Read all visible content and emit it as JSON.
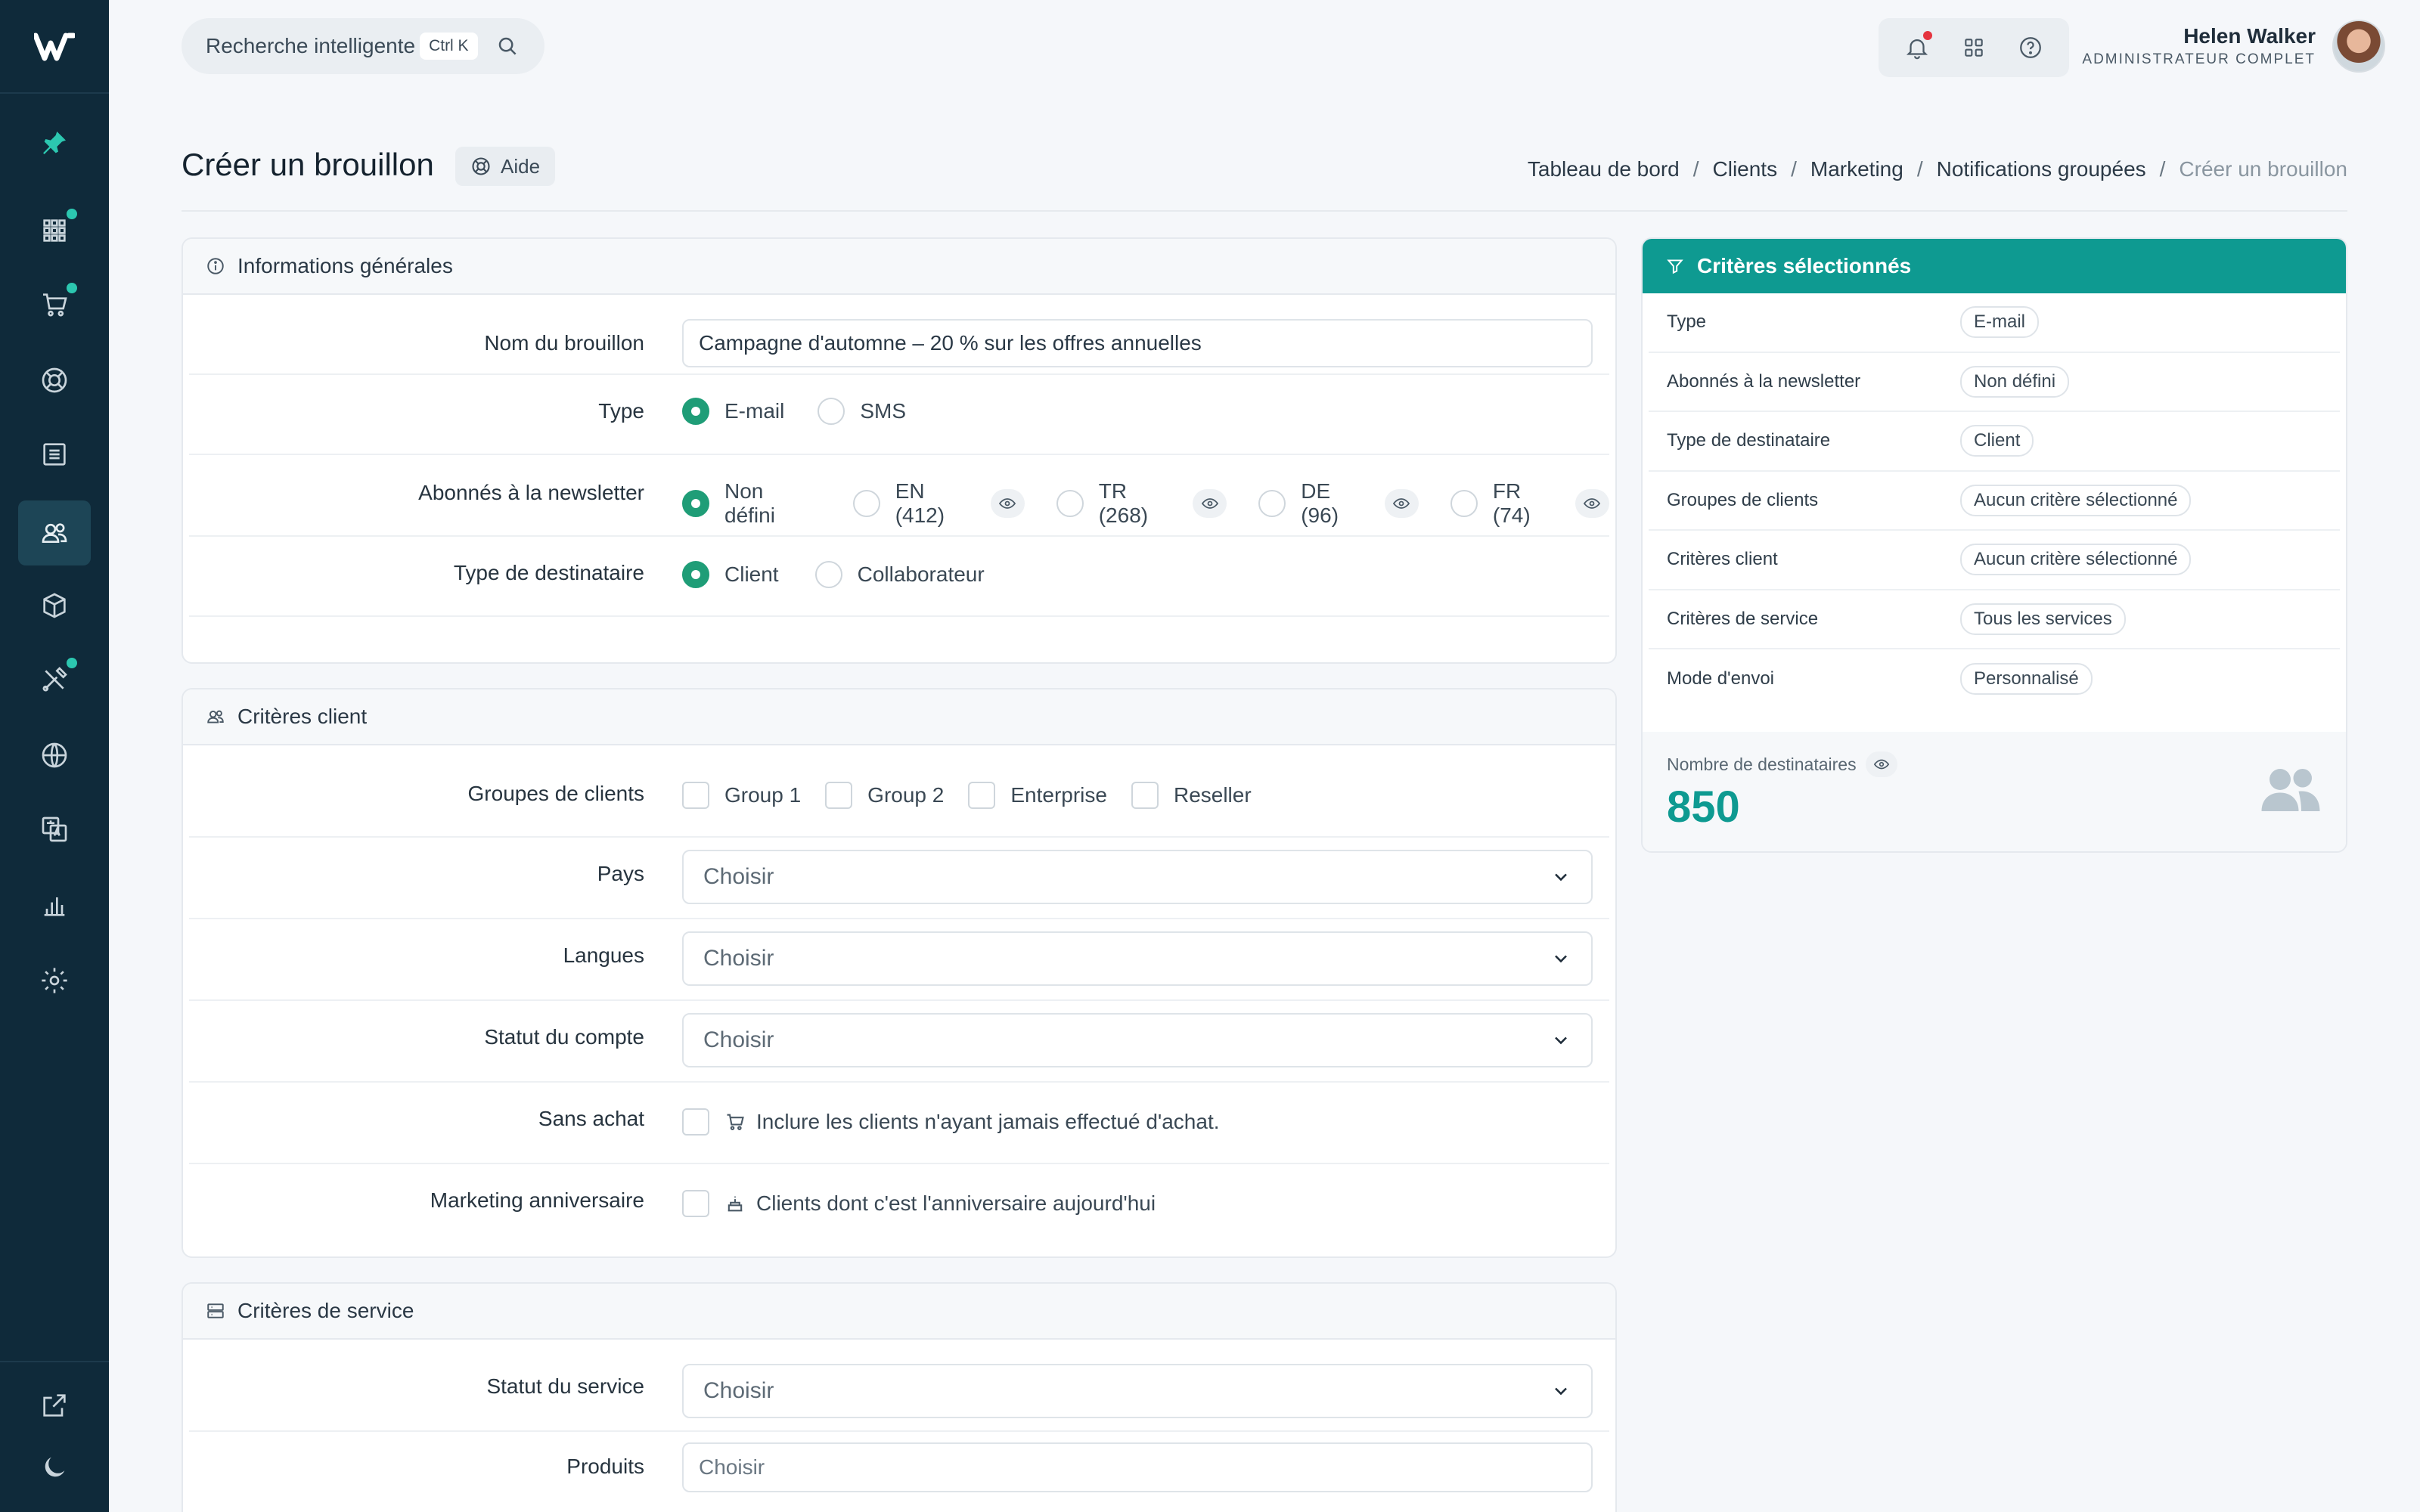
{
  "header": {
    "search_placeholder": "Recherche intelligente",
    "search_shortcut": "Ctrl K",
    "user_name": "Helen Walker",
    "user_role": "ADMINISTRATEUR COMPLET"
  },
  "page": {
    "title": "Créer un brouillon",
    "help_label": "Aide",
    "breadcrumb": [
      "Tableau de bord",
      "Clients",
      "Marketing",
      "Notifications groupées",
      "Créer un brouillon"
    ]
  },
  "general": {
    "title": "Informations générales",
    "name_label": "Nom du brouillon",
    "name_value": "Campagne d'automne – 20 % sur les offres annuelles",
    "type_label": "Type",
    "type_options": [
      "E-mail",
      "SMS"
    ],
    "newsletter_label": "Abonnés à la newsletter",
    "newsletter_options": [
      "Non défini",
      "EN (412)",
      "TR (268)",
      "DE (96)",
      "FR (74)"
    ],
    "recipient_label": "Type de destinataire",
    "recipient_options": [
      "Client",
      "Collaborateur"
    ]
  },
  "client": {
    "title": "Critères client",
    "groups_label": "Groupes de clients",
    "groups": [
      "Group 1",
      "Group 2",
      "Enterprise",
      "Reseller"
    ],
    "country_label": "Pays",
    "languages_label": "Langues",
    "status_label": "Statut du compte",
    "choose": "Choisir",
    "no_purchase_label": "Sans achat",
    "no_purchase_text": "Inclure les clients n'ayant jamais effectué d'achat.",
    "birthday_label": "Marketing anniversaire",
    "birthday_text": "Clients dont c'est l'anniversaire aujourd'hui"
  },
  "service": {
    "title": "Critères de service",
    "status_label": "Statut du service",
    "products_label": "Produits",
    "choose": "Choisir"
  },
  "summary": {
    "title": "Critères sélectionnés",
    "rows": [
      {
        "label": "Type",
        "value": "E-mail"
      },
      {
        "label": "Abonnés à la newsletter",
        "value": "Non défini"
      },
      {
        "label": "Type de destinataire",
        "value": "Client"
      },
      {
        "label": "Groupes de clients",
        "value": "Aucun critère sélectionné"
      },
      {
        "label": "Critères client",
        "value": "Aucun critère sélectionné"
      },
      {
        "label": "Critères de service",
        "value": "Tous les services"
      },
      {
        "label": "Mode d'envoi",
        "value": "Personnalisé"
      }
    ],
    "count_label": "Nombre de destinataires",
    "count_value": "850"
  }
}
